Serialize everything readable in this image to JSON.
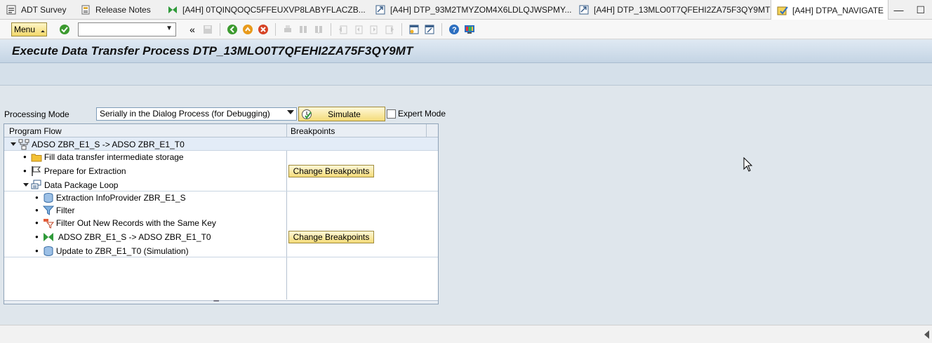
{
  "tabs": [
    {
      "label": "ADT Survey",
      "icon": "adt-icon"
    },
    {
      "label": "Release Notes",
      "icon": "notes-icon"
    },
    {
      "label": "[A4H] 0TQINQOQC5FFEUXVP8LABYFLACZB...",
      "icon": "transformation-icon"
    },
    {
      "label": "[A4H] DTP_93M2TMYZOM4X6LDLQJWSPMY...",
      "icon": "dtp-icon"
    },
    {
      "label": "[A4H] DTP_13MLO0T7QFEHI2ZA75F3QY9MT",
      "icon": "dtp-icon"
    },
    {
      "label": "[A4H] DTPA_NAVIGATE",
      "icon": "navigate-icon",
      "active": true
    }
  ],
  "toolbar": {
    "menu_label": "Menu",
    "command_field_value": ""
  },
  "page": {
    "title": "Execute Data Transfer Process DTP_13MLO0T7QFEHI2ZA75F3QY9MT"
  },
  "processing": {
    "label": "Processing Mode",
    "selected": "Serially in the Dialog Process (for Debugging)",
    "simulate_label": "Simulate",
    "expert_mode_label": "Expert Mode",
    "expert_mode_checked": false
  },
  "tree": {
    "col_flow": "Program Flow",
    "col_breakpoints": "Breakpoints",
    "rows": [
      {
        "label": "ADSO ZBR_E1_S -> ADSO ZBR_E1_T0",
        "icon": "dataflow-icon",
        "level": 0,
        "expanded": true
      },
      {
        "label": "Fill data transfer intermediate storage",
        "icon": "folder-icon",
        "level": 1
      },
      {
        "label": "Prepare for Extraction",
        "icon": "flag-icon",
        "level": 1,
        "breakpoint": "Change Breakpoints"
      },
      {
        "label": "Data Package Loop",
        "icon": "loop-icon",
        "level": 1,
        "expanded": true
      },
      {
        "label": "Extraction InfoProvider ZBR_E1_S",
        "icon": "database-icon",
        "level": 2
      },
      {
        "label": "Filter",
        "icon": "filter-icon",
        "level": 2
      },
      {
        "label": "Filter Out New Records with the Same Key",
        "icon": "filter-key-icon",
        "level": 2
      },
      {
        "label": "ADSO ZBR_E1_S -> ADSO ZBR_E1_T0",
        "icon": "transformation-icon",
        "level": 2,
        "breakpoint": "Change Breakpoints"
      },
      {
        "label": "Update to ZBR_E1_T0 (Simulation)",
        "icon": "database-icon",
        "level": 2
      }
    ]
  },
  "colors": {
    "title_bg": "#c4d4e4",
    "button_yellow": "#f4dc7a",
    "tree_border": "#8fa3b8"
  }
}
